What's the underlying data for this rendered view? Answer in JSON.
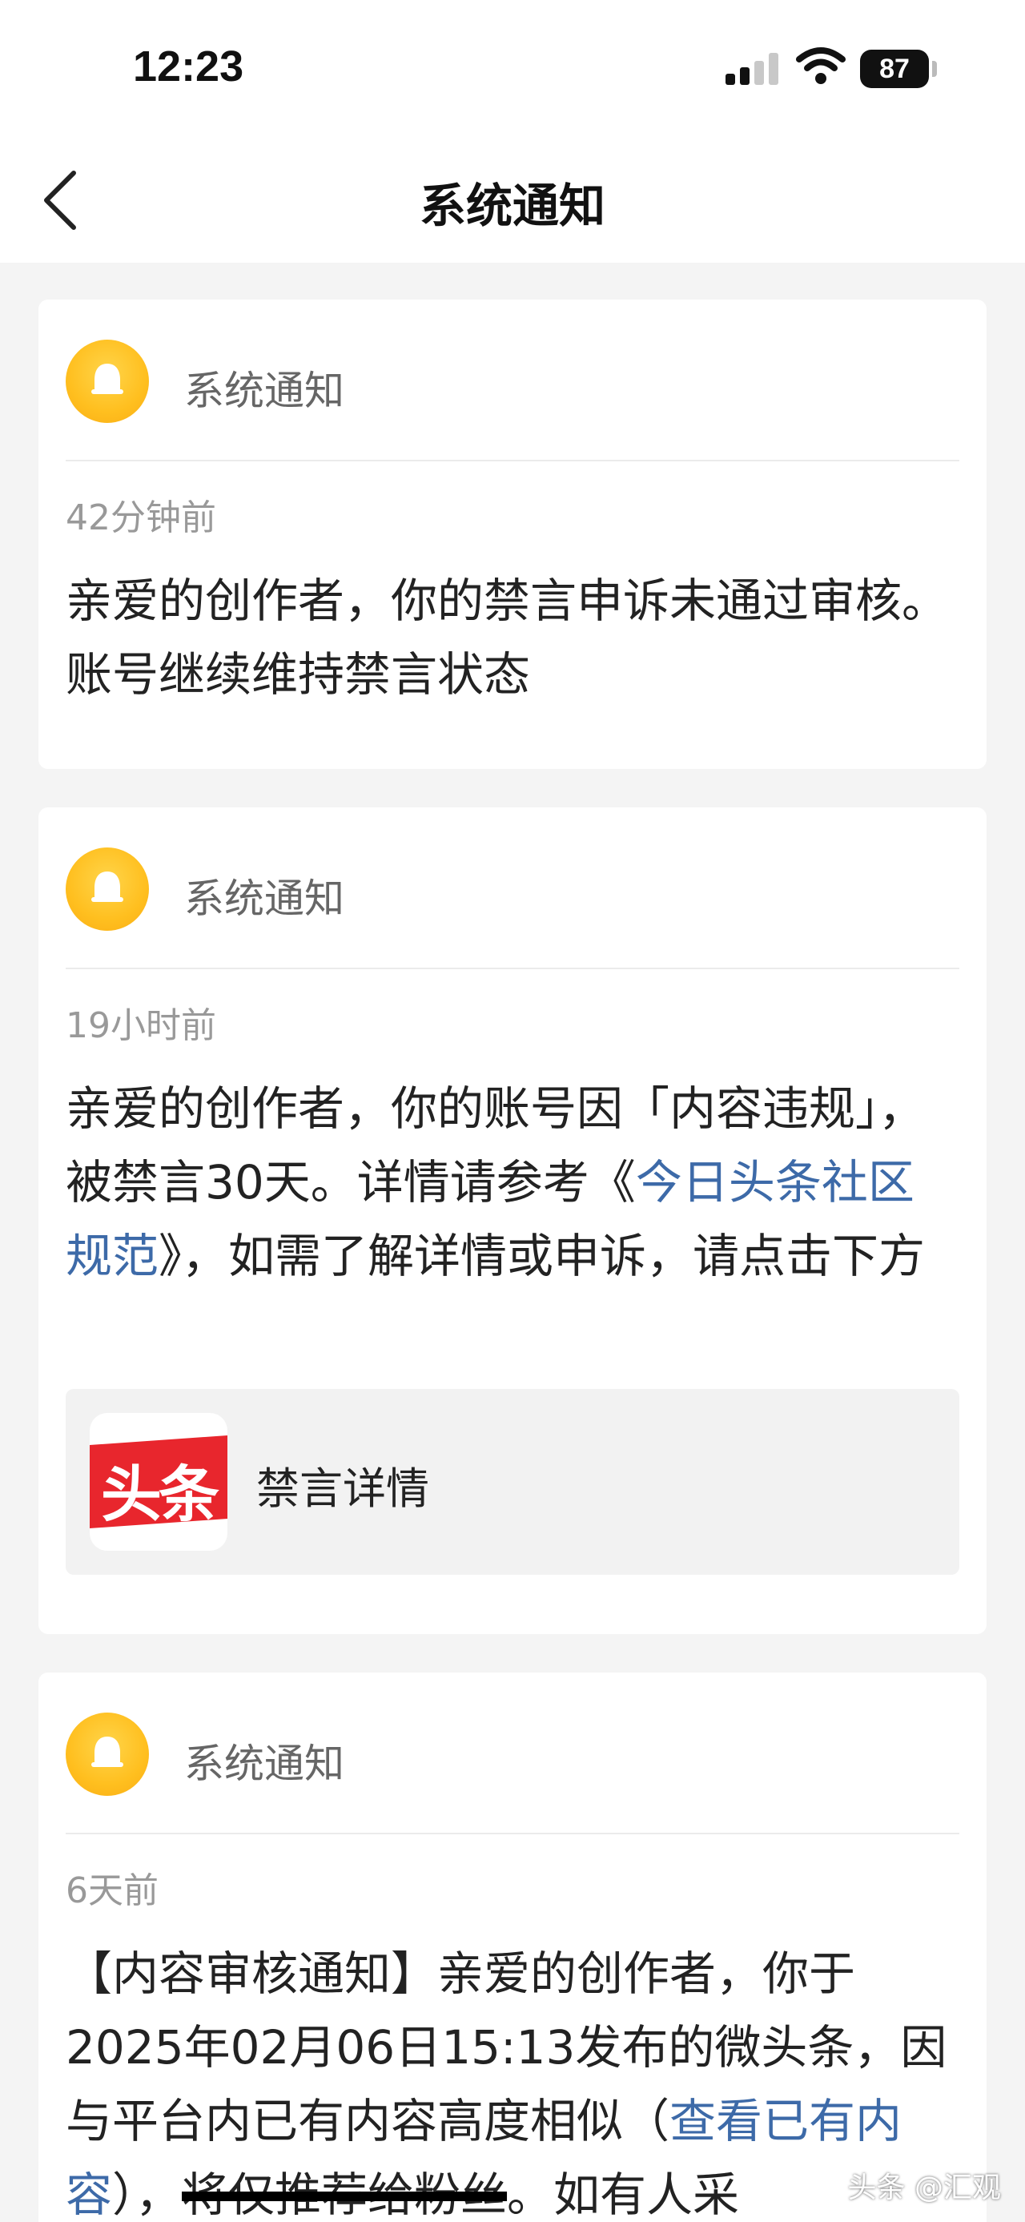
{
  "status_bar": {
    "time": "12:23",
    "battery": "87"
  },
  "nav": {
    "title": "系统通知"
  },
  "notifications": [
    {
      "sender": "系统通知",
      "time": "42分钟前",
      "body": "亲爱的创作者，你的禁言申诉未通过审核。账号继续维持禁言状态"
    },
    {
      "sender": "系统通知",
      "time": "19小时前",
      "body_pre": "亲爱的创作者，你的账号因「内容违规」，被禁言30天。详情请参考《",
      "body_link": "今日头条社区规范",
      "body_post": "》，如需了解详情或申诉，请点击下方",
      "detail_logo_text": "头条",
      "detail_label": "禁言详情"
    },
    {
      "sender": "系统通知",
      "time": "6天前",
      "body_pre": "【内容审核通知】亲爱的创作者，你于2025年02月06日15:13发布的微头条，因与平台内已有内容高度相似（",
      "body_link": "查看已有内容",
      "body_mid": "），",
      "body_struck": "将仅推荐给粉丝",
      "body_post": "。如有人采"
    }
  ],
  "watermark": "头条 @汇观"
}
